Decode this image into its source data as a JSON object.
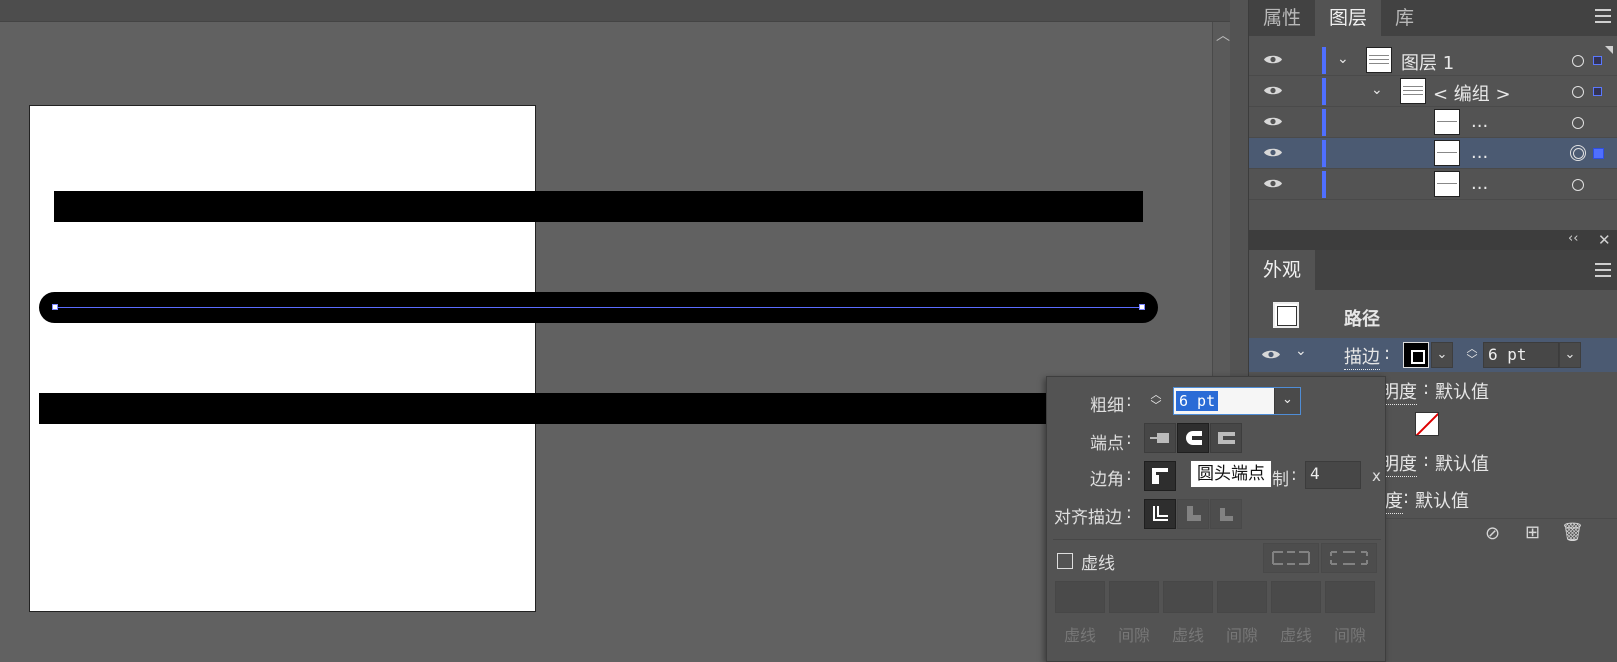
{
  "layers_panel": {
    "tabs": [
      "属性",
      "图层",
      "库"
    ],
    "active_tab": 1,
    "rows": [
      {
        "name": "图层 1",
        "level": 0,
        "expanded": true
      },
      {
        "name": "< 编组 >",
        "level": 1,
        "expanded": true
      },
      {
        "name": "...",
        "level": 2
      },
      {
        "name": "...",
        "level": 2,
        "selected": true
      },
      {
        "name": "...",
        "level": 2
      }
    ]
  },
  "appearance_panel": {
    "tab": "外观",
    "object_type": "路径",
    "stroke_label": "描边",
    "stroke_weight": "6 pt",
    "opacity_label": "不透明度",
    "opacity_value": "默认值",
    "opacity_label_partial": "度",
    "colon": ":"
  },
  "stroke_flyout": {
    "weight_label": "粗细",
    "weight_value": "6 pt",
    "cap_label": "端点",
    "corner_label": "边角",
    "limit_label_partial": "制",
    "limit_value": "4",
    "limit_unit": "x",
    "align_label": "对齐描边",
    "dashed_label": "虚线",
    "dashed_checked": false,
    "dash_cells": [
      "虚线",
      "间隙",
      "虚线",
      "间隙",
      "虚线",
      "间隙"
    ],
    "colon": ":",
    "tooltip": "圆头端点"
  },
  "colors": {
    "selection": "#4f6fff",
    "canvas": "#616161",
    "panel": "#535353"
  }
}
